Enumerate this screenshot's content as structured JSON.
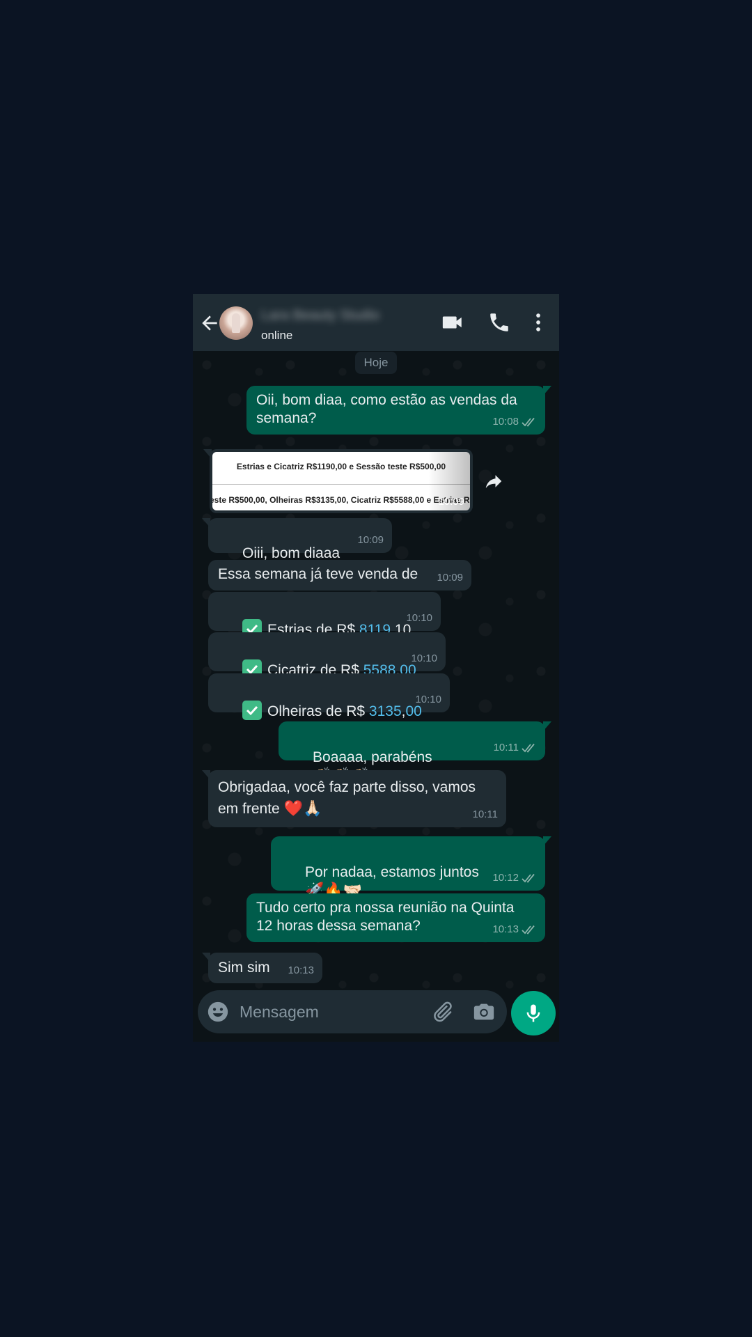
{
  "header": {
    "contact_name": "Lara Beauty Studio",
    "status": "online"
  },
  "chat": {
    "date_chip": "Hoje",
    "messages": [
      {
        "text": "Oii, bom diaa, como estão as vendas da\nsemana?",
        "time": "10:08"
      },
      {
        "image_line1": "Estrias e Cicatriz R$1190,00 e Sessão teste R$500,00",
        "image_line2": "este R$500,00, Olheiras R$3135,00, Cicatriz R$5588,00 e Estrias R",
        "time": "10:09"
      },
      {
        "text": "Oiii, bom diaaa",
        "emoji": "🤗",
        "time": "10:09"
      },
      {
        "text": "Essa semana já teve venda de",
        "time": "10:09"
      },
      {
        "prefix": "Estrias de R$ ",
        "num": "8119",
        "suffix": ",10",
        "time": "10:10"
      },
      {
        "prefix": "Cicatriz de R$ ",
        "num": "5588",
        "sep": ",",
        "num2": "00",
        "time": "10:10"
      },
      {
        "prefix": "Olheiras de R$ ",
        "num": "3135",
        "sep": ",",
        "num2": "00",
        "time": "10:10"
      },
      {
        "text": "Boaaaa, parabéns",
        "emoji": "👏🏻👏🏻👏🏻",
        "time": "10:11"
      },
      {
        "text": "Obrigadaa, você faz parte disso, vamos\nem frente",
        "emoji": "❤️🙏🏻",
        "time": "10:11"
      },
      {
        "text": "Por nadaa, estamos juntos",
        "emoji": "🚀🔥🤝🏻",
        "time": "10:12"
      },
      {
        "text": "Tudo certo pra nossa reunião na Quinta\n12 horas dessa semana?",
        "time": "10:13"
      },
      {
        "text": "Sim sim",
        "time": "10:13"
      }
    ]
  },
  "composer": {
    "placeholder": "Mensagem"
  },
  "icons": {
    "back": "back-arrow-icon",
    "video": "video-call-icon",
    "call": "phone-call-icon",
    "menu": "more-vert-icon",
    "smiley": "smiley-icon",
    "attach": "paperclip-icon",
    "camera": "camera-icon",
    "mic": "microphone-icon",
    "share": "forward-icon"
  },
  "colors": {
    "outgoing_bubble": "#005c4b",
    "incoming_bubble": "#202c33",
    "accent": "#00a884",
    "link_number": "#53bdeb",
    "read_ticks": "#8696a0"
  }
}
